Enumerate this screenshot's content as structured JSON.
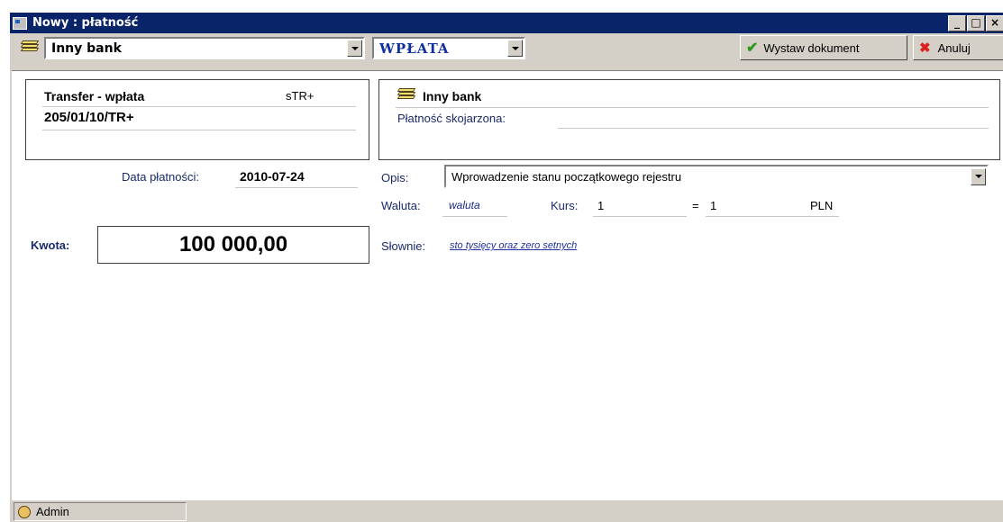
{
  "window": {
    "title": "Nowy : płatność",
    "controls": [
      "_",
      "□",
      "×"
    ]
  },
  "toolbar": {
    "bank_combo": "Inny bank",
    "type_combo": "WPŁATA",
    "issue_button": "Wystaw dokument",
    "cancel_button": "Anuluj"
  },
  "left_panel": {
    "doc_type": "Transfer - wpłata",
    "doc_code": "sTR+",
    "doc_number": "205/01/10/TR+"
  },
  "right_panel": {
    "bank_name": "Inny bank",
    "linked_label": "Płatność skojarzona:",
    "linked_value": ""
  },
  "form": {
    "date_label": "Data płatności:",
    "date_value": "2010-07-24",
    "desc_label": "Opis:",
    "desc_value": "Wprowadzenie stanu początkowego rejestru",
    "currency_label": "Waluta:",
    "currency_value": "waluta",
    "rate_label": "Kurs:",
    "rate_value": "1",
    "equals": "=",
    "rate_result": "1",
    "rate_currency": "PLN",
    "amount_label": "Kwota:",
    "amount_value": "100 000,00",
    "words_label": "Słownie:",
    "words_value": "sto tysięcy oraz zero setnych"
  },
  "status": {
    "user": "Admin"
  }
}
